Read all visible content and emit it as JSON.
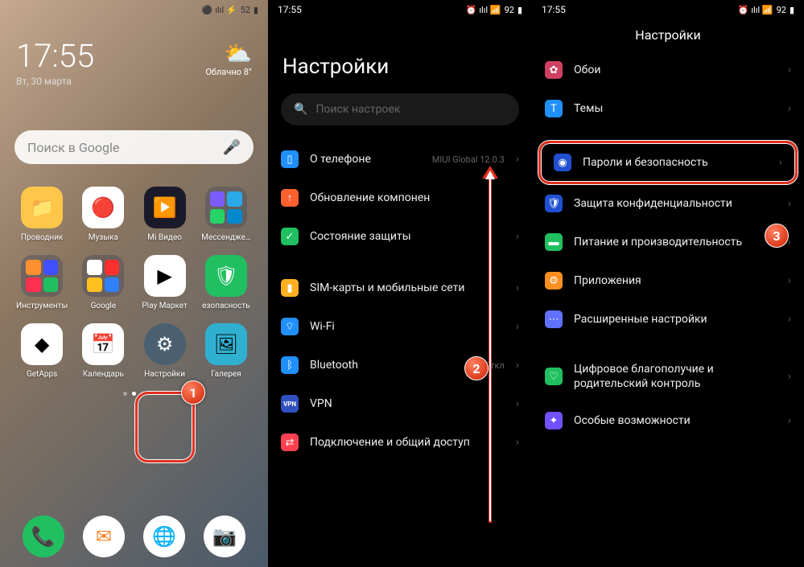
{
  "panel1": {
    "status": {
      "time_implicit": "",
      "battery": "52"
    },
    "clock": "17:55",
    "date": "Вт, 30 марта",
    "weather": {
      "condition": "Облачно",
      "temp": "8°"
    },
    "search_placeholder": "Поиск в Google",
    "apps": [
      {
        "label": "Проводник",
        "bg": "#ffc64a"
      },
      {
        "label": "Музыка",
        "bg": "#ffffff"
      },
      {
        "label": "Mi Видео",
        "bg": "#1a1a2a"
      },
      {
        "label": "Мессендже…",
        "bg": "folder"
      },
      {
        "label": "Инструменты",
        "bg": "folder"
      },
      {
        "label": "Google",
        "bg": "folder"
      },
      {
        "label": "Play Маркет",
        "bg": "#ffffff"
      },
      {
        "label": "езопасность",
        "bg": "#20c060"
      },
      {
        "label": "GetApps",
        "bg": "#ffffff"
      },
      {
        "label": "Календарь",
        "bg": "#ffffff"
      },
      {
        "label": "Настройки",
        "bg": "#4a6070"
      },
      {
        "label": "Галерея",
        "bg": "#30b0d0"
      }
    ],
    "dock": [
      "phone",
      "messages",
      "edge",
      "camera"
    ]
  },
  "panel2": {
    "status_time": "17:55",
    "status_battery": "92",
    "title": "Настройки",
    "search_placeholder": "Поиск настроек",
    "items": [
      {
        "icon_bg": "#2090ff",
        "label": "О телефоне",
        "value": "MIUI Global 12.0.3"
      },
      {
        "icon_bg": "#ff6030",
        "label": "Обновление компонен",
        "value": ""
      },
      {
        "icon_bg": "#20c060",
        "label": "Состояние защиты",
        "value": ""
      }
    ],
    "items2": [
      {
        "icon_bg": "#ffb020",
        "label": "SIM-карты и мобильные сети",
        "value": ""
      },
      {
        "icon_bg": "#2090ff",
        "label": "Wi-Fi",
        "value": ""
      },
      {
        "icon_bg": "#2090ff",
        "label": "Bluetooth",
        "value": "Откл"
      },
      {
        "icon_bg": "#3050c0",
        "label": "VPN",
        "value": ""
      },
      {
        "icon_bg": "#ff4050",
        "label": "Подключение и общий доступ",
        "value": ""
      }
    ]
  },
  "panel3": {
    "status_time": "17:55",
    "status_battery": "92",
    "title": "Настройки",
    "items_top": [
      {
        "icon_bg": "#d04060",
        "label": "Обои"
      },
      {
        "icon_bg": "#2090ff",
        "label": "Темы"
      }
    ],
    "highlighted": {
      "icon_bg": "#2050d0",
      "label": "Пароли и безопасность"
    },
    "items_mid": [
      {
        "icon_bg": "#2050d0",
        "label": "Защита конфиденциальности"
      },
      {
        "icon_bg": "#20c060",
        "label": "Питание и производительность"
      },
      {
        "icon_bg": "#ff9020",
        "label": "Приложения"
      },
      {
        "icon_bg": "#6070ff",
        "label": "Расширенные настройки"
      }
    ],
    "items_bot": [
      {
        "icon_bg": "#20c060",
        "label": "Цифровое благополучие и родительский контроль"
      },
      {
        "icon_bg": "#7050ff",
        "label": "Особые возможности"
      }
    ]
  },
  "callouts": {
    "c1": "1",
    "c2": "2",
    "c3": "3"
  }
}
